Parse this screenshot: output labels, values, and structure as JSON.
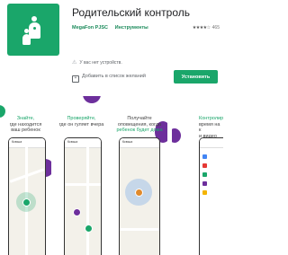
{
  "app": {
    "title": "Родительский контроль",
    "developer": "MegaFon PJSC",
    "category": "Инструменты",
    "rating_stars": "★★★★☆",
    "rating_count": "465",
    "no_device_warning": "У вас нет устройств.",
    "wishlist_label": "Добавить в список желаний",
    "install_label": "Установить"
  },
  "screenshots": [
    {
      "line1": "Знайте,",
      "line2": "где находится",
      "line3": "ваш ребенок",
      "tab": "Ксюша"
    },
    {
      "line1": "Проверяйте,",
      "line2": "где он гуляет вчера",
      "line3": "",
      "tab": "Ксюша"
    },
    {
      "line1": "Получайте",
      "line2": "оповещения, когда",
      "line3": "ребенок будет дома",
      "tab": "Ксюша"
    },
    {
      "line1": "Контролир",
      "line2": "время на к",
      "line3": "и видео",
      "tab": ""
    }
  ],
  "colors": {
    "brand": "#1aa66a",
    "accent": "#6d2f9c"
  }
}
